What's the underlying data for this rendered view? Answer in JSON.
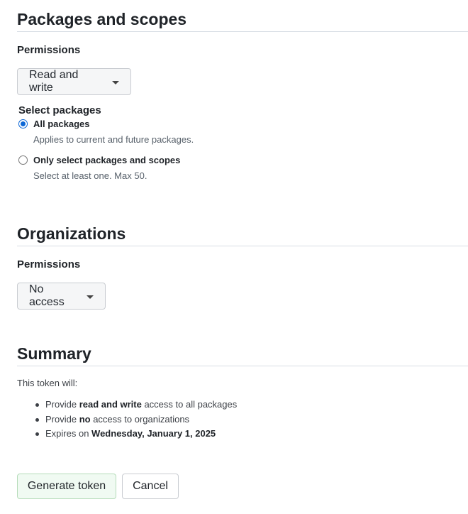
{
  "packages": {
    "title": "Packages and scopes",
    "permissions_label": "Permissions",
    "permissions_value": "Read and write",
    "select_label": "Select packages",
    "options": [
      {
        "title": "All packages",
        "note": "Applies to current and future packages.",
        "checked": true
      },
      {
        "title": "Only select packages and scopes",
        "note": "Select at least one. Max 50.",
        "checked": false
      }
    ]
  },
  "organizations": {
    "title": "Organizations",
    "permissions_label": "Permissions",
    "permissions_value": "No access"
  },
  "summary": {
    "title": "Summary",
    "intro": "This token will:",
    "items": [
      {
        "before": "Provide ",
        "bold": "read and write",
        "after": " access to all packages"
      },
      {
        "before": "Provide ",
        "bold": "no",
        "after": " access to organizations"
      },
      {
        "before": "Expires on ",
        "bold": "Wednesday, January 1, 2025",
        "after": ""
      }
    ]
  },
  "buttons": {
    "generate": "Generate token",
    "cancel": "Cancel"
  },
  "colors": {
    "radio_checked": "#0b67d6",
    "primary_button_bg": "#f0faf2",
    "primary_button_border": "#b5dcb9"
  }
}
